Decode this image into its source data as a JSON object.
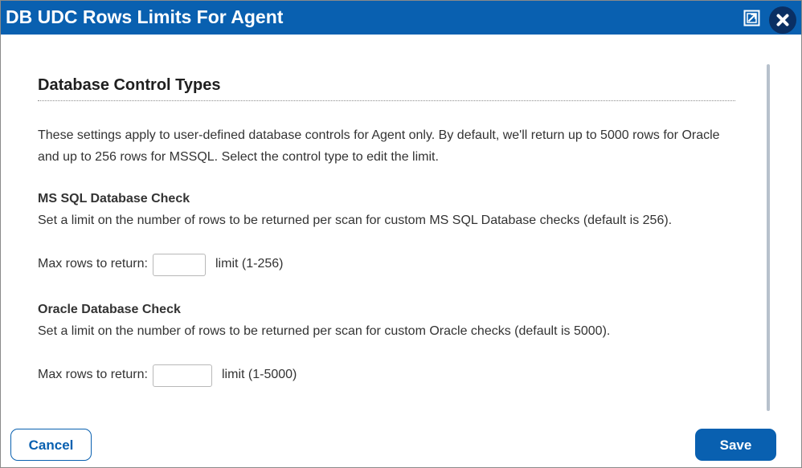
{
  "window": {
    "title": "DB UDC Rows Limits For Agent",
    "maximize_icon": "maximize-icon",
    "close_icon": "close-icon"
  },
  "main": {
    "section_title": "Database Control Types",
    "intro_line1": "These settings apply to user-defined database controls for Agent only. By default, we'll return up to 5000 rows for Oracle",
    "intro_line2": "and up to 256 rows for MSSQL. Select the control type to edit the limit.",
    "mssql": {
      "heading": "MS SQL Database Check",
      "description": "Set a limit on the number of rows to be returned per scan for custom MS SQL Database checks (default is 256).",
      "field_label": "Max rows to return:",
      "value": "",
      "hint": "limit (1-256)"
    },
    "oracle": {
      "heading": "Oracle Database Check",
      "description": "Set a limit on the number of rows to be returned per scan for custom Oracle checks (default is 5000).",
      "field_label": "Max rows to return:",
      "value": "",
      "hint": "limit (1-5000)"
    }
  },
  "footer": {
    "cancel_label": "Cancel",
    "save_label": "Save"
  },
  "colors": {
    "title_bar": "#0960b0",
    "close_button": "#0a2f63",
    "primary": "#0960b0"
  }
}
